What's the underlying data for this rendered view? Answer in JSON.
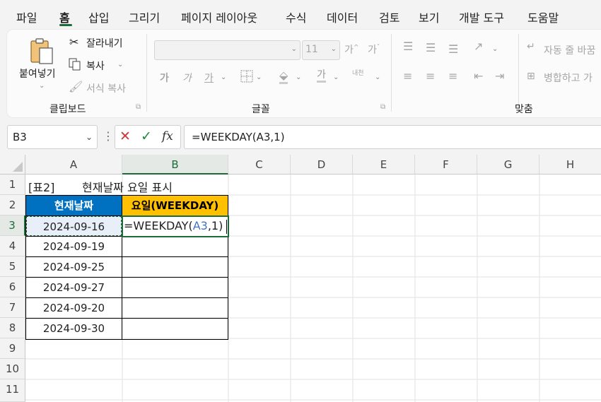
{
  "menu": {
    "items": [
      "파일",
      "홈",
      "삽입",
      "그리기",
      "페이지 레이아웃",
      "수식",
      "데이터",
      "검토",
      "보기",
      "개발 도구",
      "도움말"
    ]
  },
  "ribbon": {
    "paste_label": "붙여넣기",
    "cut_label": "잘라내기",
    "copy_label": "복사",
    "format_painter_label": "서식 복사",
    "clipboard_group": "클립보드",
    "font_size": "11",
    "font_group": "글꼴",
    "wrap_text_label": "자동 줄 바꿈",
    "merge_label": "병합하고 가",
    "align_group": "맞춤",
    "bold_glyph": "가",
    "italic_glyph": "가",
    "underline_glyph": "가",
    "font_color_glyph": "가",
    "phonetic_glyph": "내천"
  },
  "formula_bar": {
    "name_box": "B3",
    "fx": "fx",
    "formula": "=WEEKDAY(A3,1)"
  },
  "sheet": {
    "columns": [
      "A",
      "B",
      "C",
      "D",
      "E",
      "F",
      "G",
      "H"
    ],
    "rows": [
      "1",
      "2",
      "3",
      "4",
      "5",
      "6",
      "7",
      "8",
      "9",
      "10",
      "11"
    ],
    "title_tag": "[표2]",
    "title": "현재날짜 요일 표시",
    "header_a": "현재날짜",
    "header_b": "요일(WEEKDAY)",
    "dates": [
      "2024-09-16",
      "2024-09-19",
      "2024-09-25",
      "2024-09-27",
      "2024-09-20",
      "2024-09-30"
    ],
    "edit_prefix": "=WEEKDAY(",
    "edit_ref": "A3",
    "edit_suffix": ",1)"
  },
  "colors": {
    "header_a_bg": "#0070c0",
    "header_b_bg": "#ffc000",
    "accent_green": "#1e6b3a",
    "ref_blue": "#4472c4"
  }
}
